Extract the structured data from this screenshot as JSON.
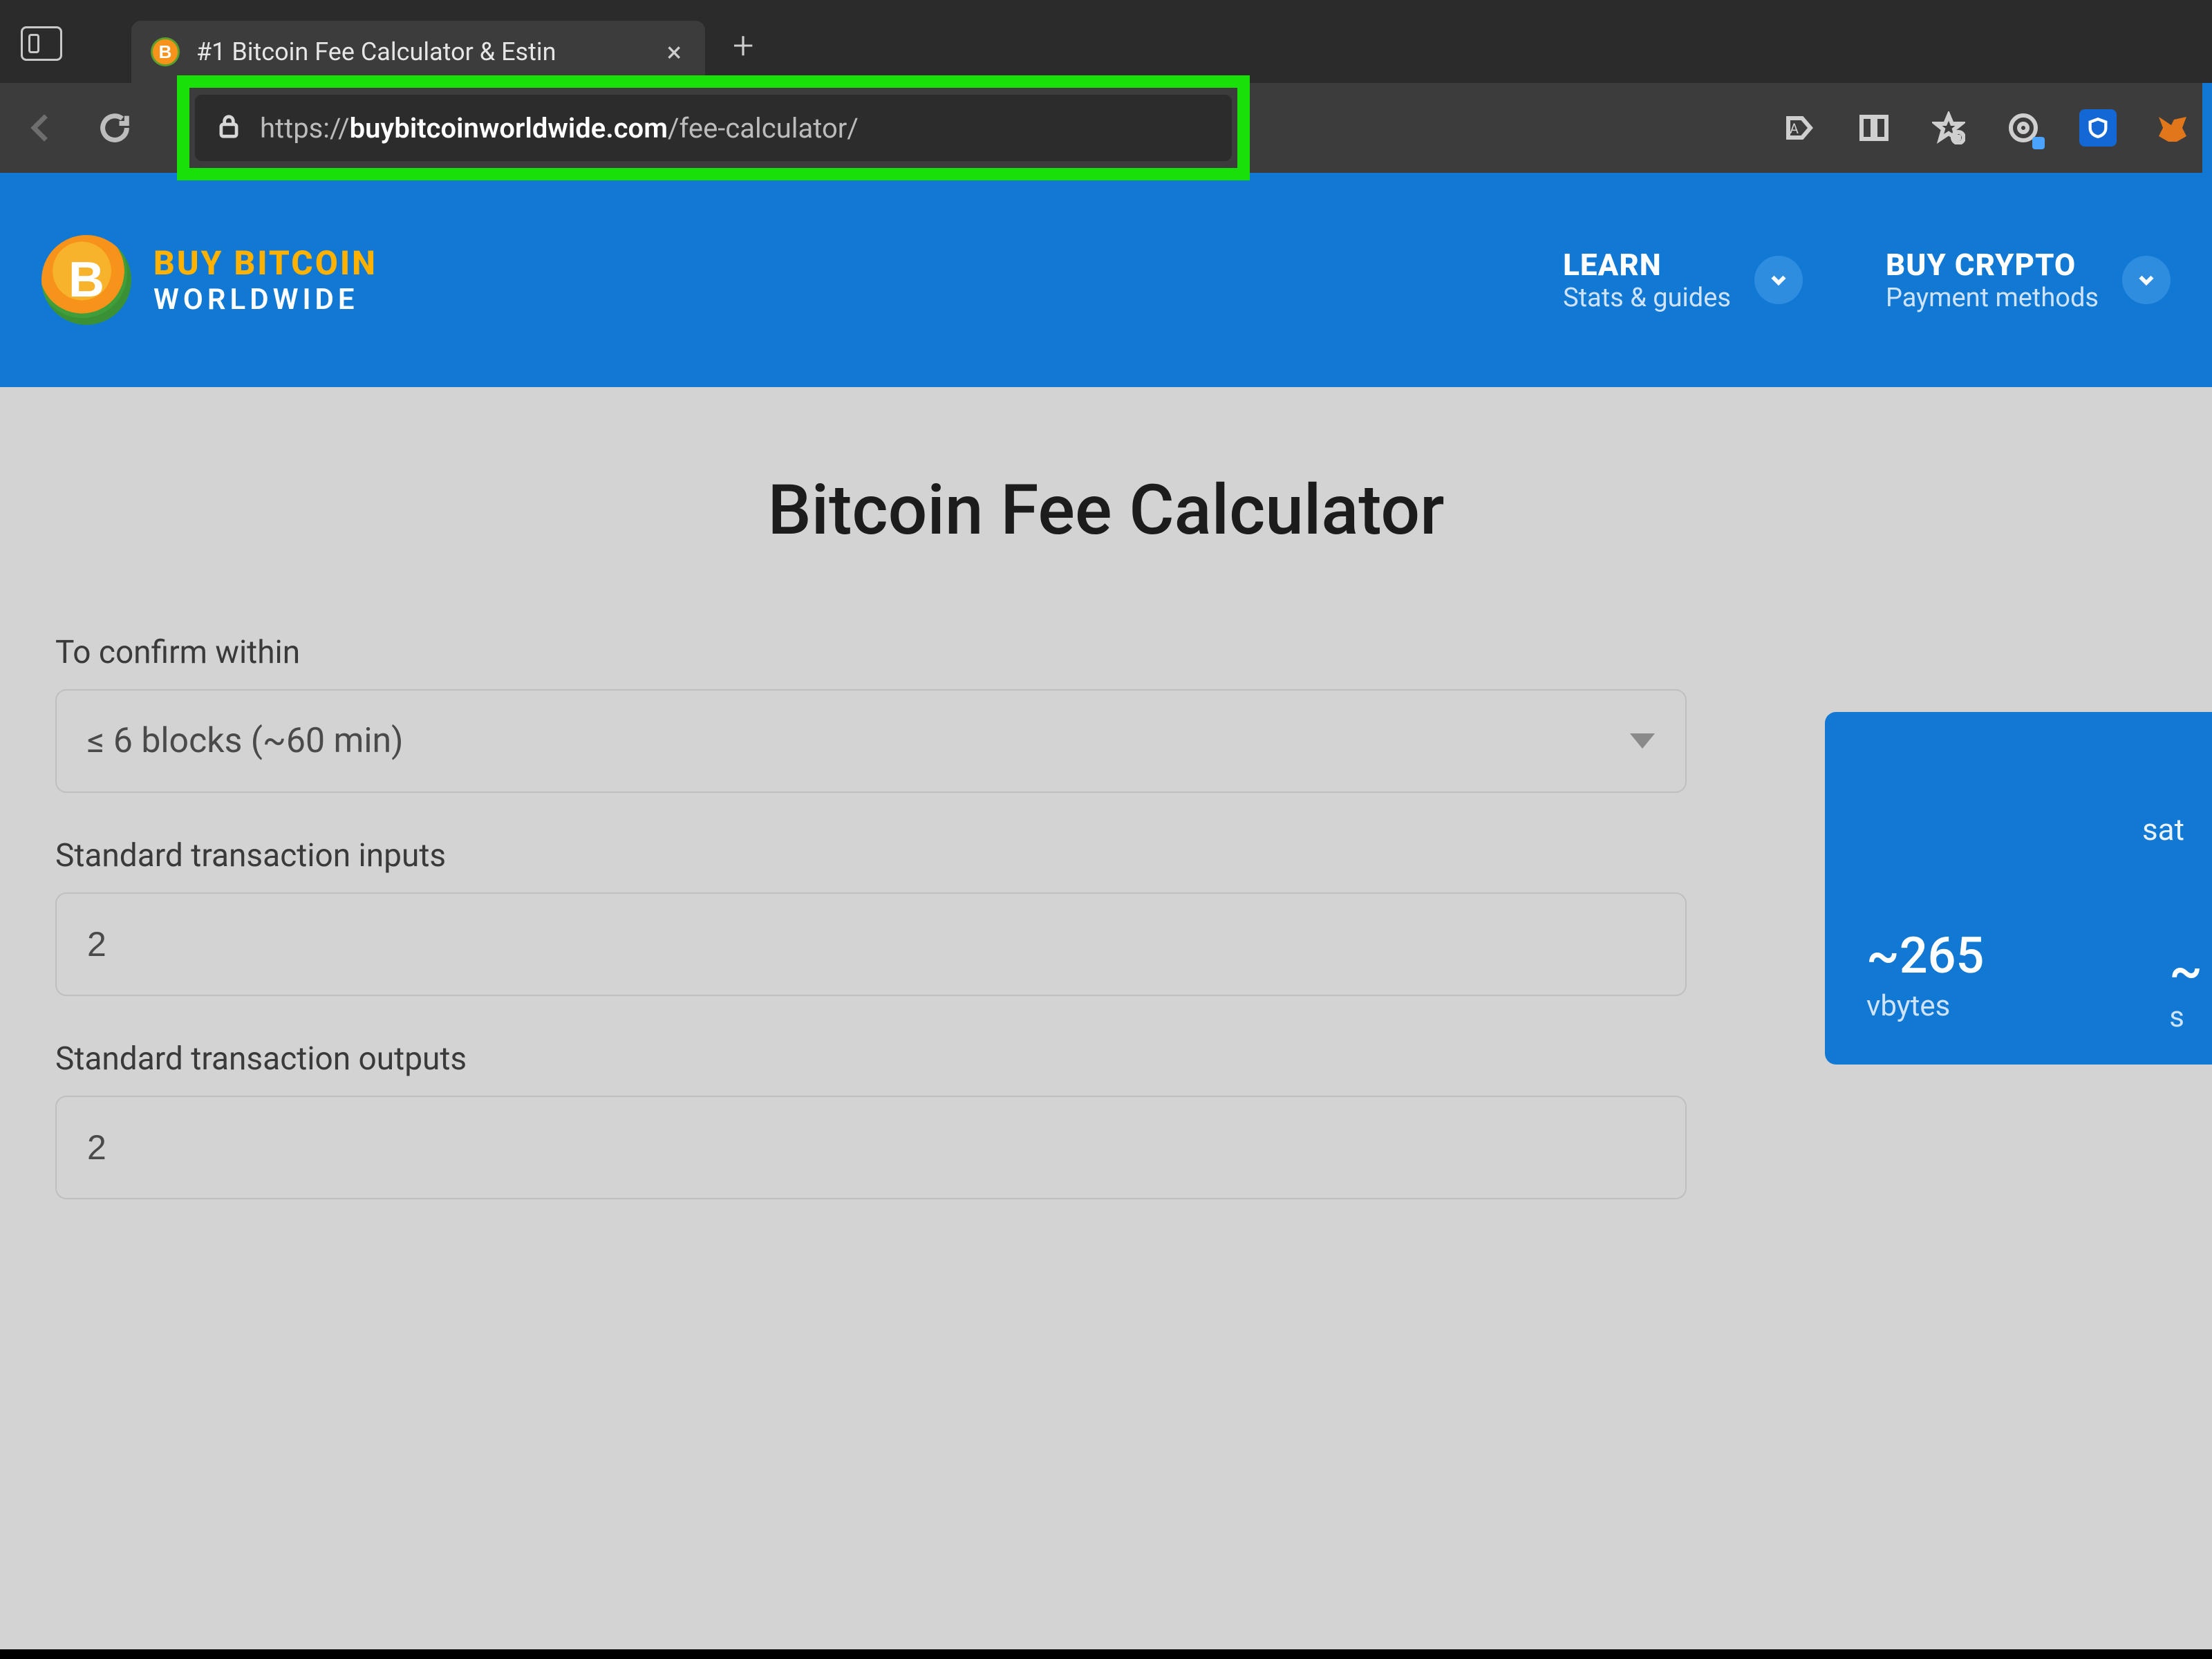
{
  "browser": {
    "tab_title": "#1 Bitcoin Fee Calculator & Estin",
    "tab_favicon_letter": "B",
    "url_protocol": "https://",
    "url_host": "buybitcoinworldwide.com",
    "url_path": "/fee-calculator/"
  },
  "site_header": {
    "logo_letter": "B",
    "logo_line1": "BUY BITCOIN",
    "logo_line2": "WORLDWIDE",
    "nav": [
      {
        "title": "LEARN",
        "subtitle": "Stats & guides"
      },
      {
        "title": "BUY CRYPTO",
        "subtitle": "Payment methods"
      }
    ]
  },
  "page": {
    "title": "Bitcoin Fee Calculator",
    "confirm_label": "To confirm within",
    "confirm_value": "≤ 6 blocks (~60 min)",
    "inputs_label": "Standard transaction inputs",
    "inputs_value": "2",
    "outputs_label": "Standard transaction outputs",
    "outputs_value": "2"
  },
  "side_card": {
    "top_right_label": "sat",
    "stat_value": "~265",
    "stat_unit": "vbytes",
    "right_value": "~",
    "right_unit": "s"
  }
}
